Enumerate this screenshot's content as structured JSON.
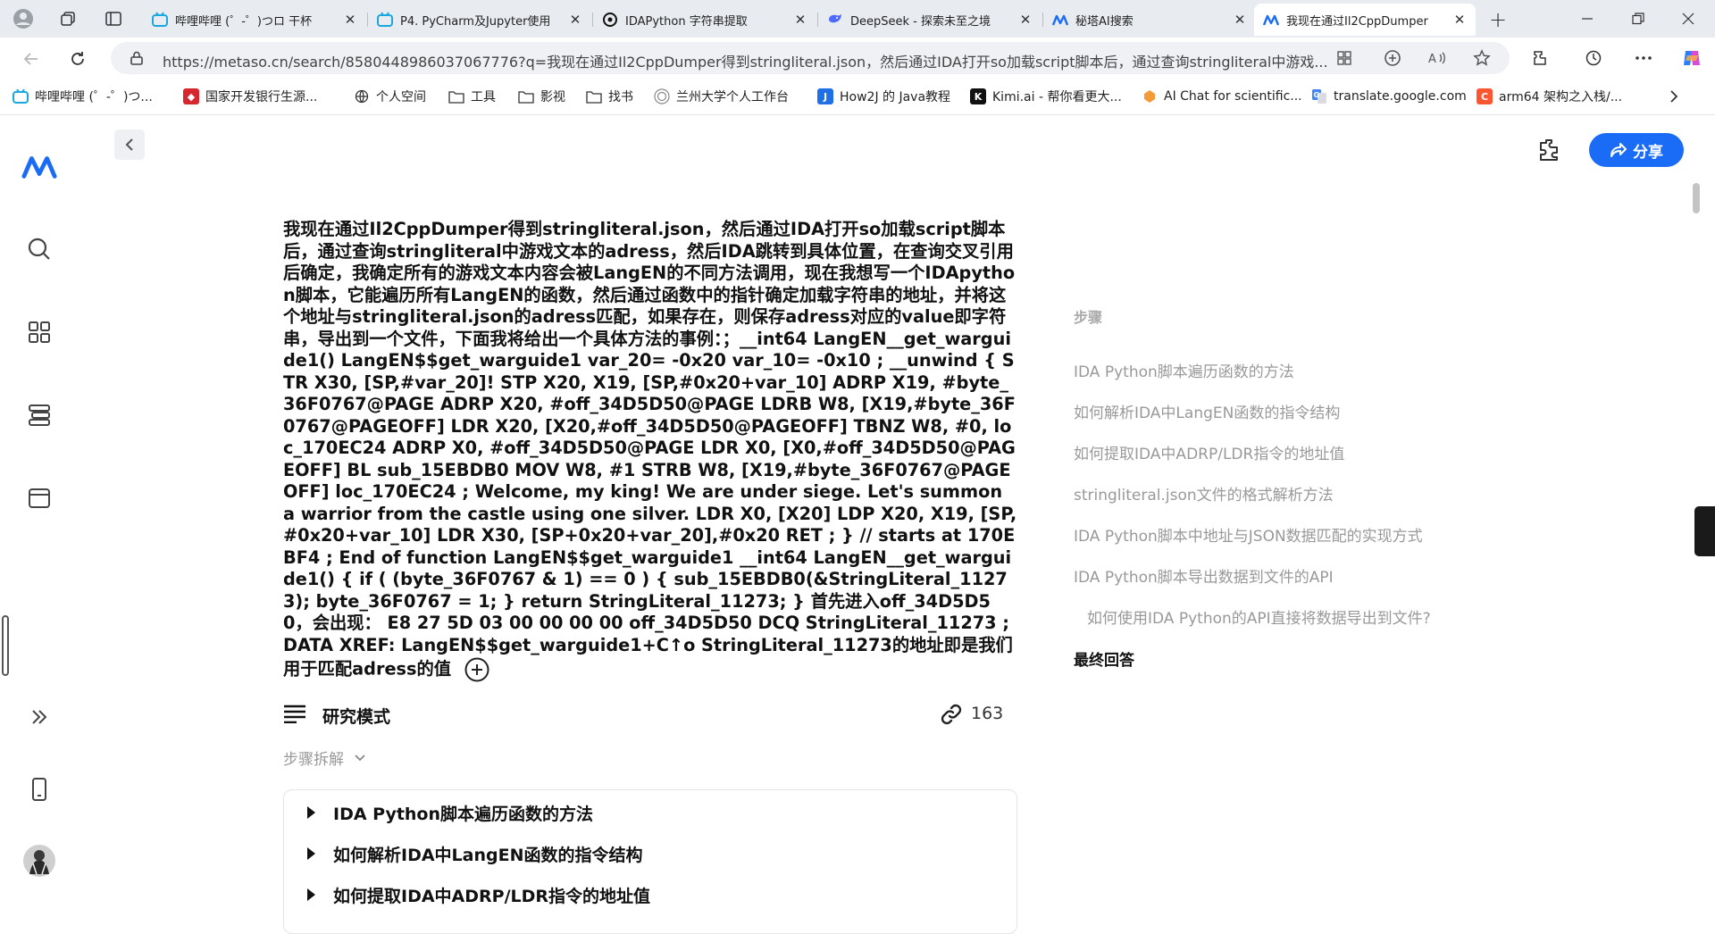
{
  "browser": {
    "tabs": [
      {
        "title": "哔哩哔哩 (゜-゜)つロ 干杯",
        "active": false
      },
      {
        "title": "P4. PyCharm及Jupyter使用",
        "active": false
      },
      {
        "title": "IDAPython 字符串提取",
        "active": false
      },
      {
        "title": "DeepSeek - 探索未至之境",
        "active": false
      },
      {
        "title": "秘塔AI搜索",
        "active": false
      },
      {
        "title": "我现在通过Il2CppDumper",
        "active": true
      }
    ],
    "url": "https://metaso.cn/search/8580448986037067776?q=我现在通过Il2CppDumper得到stringliteral.json，然后通过IDA打开so加载script脚本后，通过查询stringliteral中游戏...",
    "bookmarks": [
      "哔哩哔哩 (゜-゜)つ...",
      "国家开发银行生源...",
      "个人空间",
      "工具",
      "影视",
      "找书",
      "兰州大学个人工作台",
      "How2J 的 Java教程",
      "Kimi.ai - 帮你看更大...",
      "AI Chat for scientific...",
      "translate.google.com",
      "arm64 架构之入栈/..."
    ]
  },
  "page": {
    "share_label": "分享",
    "question_text": "我现在通过Il2CppDumper得到stringliteral.json，然后通过IDA打开so加载script脚本后，通过查询stringliteral中游戏文本的adress，然后IDA跳转到具体位置，在查询交叉引用后确定，我确定所有的游戏文本内容会被LangEN的不同方法调用，现在我想写一个IDApython脚本，它能遍历所有LangEN的函数，然后通过函数中的指针确定加载字符串的地址，并将这个地址与stringliteral.json的adress匹配，如果存在，则保存adress对应的value即字符串，导出到一个文件，下面我将给出一个具体方法的事例：；__int64 LangEN__get_warguide1() LangEN$$get_warguide1 var_20= -0x20 var_10= -0x10 ; __unwind { STR X30, [SP,#var_20]! STP X20, X19, [SP,#0x20+var_10] ADRP X19, #byte_36F0767@PAGE ADRP X20, #off_34D5D50@PAGE LDRB W8, [X19,#byte_36F0767@PAGEOFF] LDR X20, [X20,#off_34D5D50@PAGEOFF] TBNZ W8, #0, loc_170EC24 ADRP X0, #off_34D5D50@PAGE LDR X0, [X0,#off_34D5D50@PAGEOFF] BL sub_15EBDB0 MOV W8, #1 STRB W8, [X19,#byte_36F0767@PAGEOFF] loc_170EC24 ; Welcome, my king! We are under siege. Let's summon a warrior from the castle using one silver. LDR X0, [X20] LDP X20, X19, [SP,#0x20+var_10] LDR X30, [SP+0x20+var_20],#0x20 RET ; } // starts at 170EBF4 ; End of function LangEN$$get_warguide1 __int64 LangEN__get_warguide1() { if ( (byte_36F0767 & 1) == 0 ) { sub_15EBDB0(&StringLiteral_11273); byte_36F0767 = 1; } return StringLiteral_11273; } 首先进入off_34D5D50，会出现： E8 27 5D 03 00 00 00 00 off_34D5D50 DCQ StringLiteral_11273 ; DATA XREF: LangEN$$get_warguide1+C↑o StringLiteral_11273的地址即是我们用于匹配adress的值",
    "research_mode_label": "研究模式",
    "source_count": "163",
    "steps_toggle_label": "步骤拆解",
    "steps": [
      "IDA Python脚本遍历函数的方法",
      "如何解析IDA中LangEN函数的指令结构",
      "如何提取IDA中ADRP/LDR指令的地址值"
    ]
  },
  "toc": {
    "heading": "步骤",
    "items": [
      {
        "label": "IDA Python脚本遍历函数的方法",
        "level": 1
      },
      {
        "label": "如何解析IDA中LangEN函数的指令结构",
        "level": 1
      },
      {
        "label": "如何提取IDA中ADRP/LDR指令的地址值",
        "level": 1
      },
      {
        "label": "stringliteral.json文件的格式解析方法",
        "level": 1
      },
      {
        "label": "IDA Python脚本中地址与JSON数据匹配的实现方式",
        "level": 1
      },
      {
        "label": "IDA Python脚本导出数据到文件的API",
        "level": 1
      },
      {
        "label": "如何使用IDA Python的API直接将数据导出到文件?",
        "level": 2
      }
    ],
    "final_label": "最终回答"
  },
  "colors": {
    "accent": "#1a6cf6",
    "tab_strip": "#e8ebef",
    "toc_text": "#999999"
  }
}
